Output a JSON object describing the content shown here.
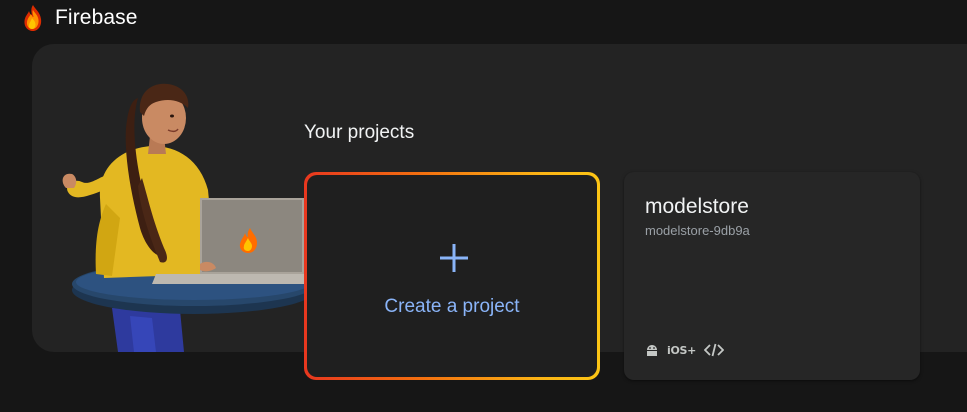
{
  "app": {
    "name": "Firebase"
  },
  "projects_section": {
    "title": "Your projects"
  },
  "create_card": {
    "label": "Create a project"
  },
  "projects": [
    {
      "name": "modelstore",
      "id": "modelstore-9db9a",
      "platforms": [
        "android-icon",
        "ios-icon",
        "web-code-icon"
      ],
      "ios_label": "iOS+"
    }
  ],
  "colors": {
    "background": "#161616",
    "panel": "#232323",
    "accent_link": "#8ab4f8",
    "gradient_start": "#e8371f",
    "gradient_end": "#fcc515"
  }
}
